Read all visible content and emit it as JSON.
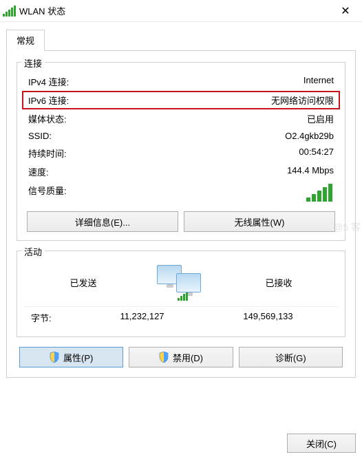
{
  "window": {
    "title": "WLAN 状态",
    "close": "✕"
  },
  "tab": {
    "general": "常规"
  },
  "connection": {
    "legend": "连接",
    "ipv4_label": "IPv4 连接:",
    "ipv4_value": "Internet",
    "ipv6_label": "IPv6 连接:",
    "ipv6_value": "无网络访问权限",
    "media_label": "媒体状态:",
    "media_value": "已启用",
    "ssid_label": "SSID:",
    "ssid_value": "O2.4gkb29b",
    "duration_label": "持续时间:",
    "duration_value": "00:54:27",
    "speed_label": "速度:",
    "speed_value": "144.4 Mbps",
    "signal_label": "信号质量:"
  },
  "buttons": {
    "details": "详细信息(E)...",
    "wireless": "无线属性(W)",
    "properties": "属性(P)",
    "disable": "禁用(D)",
    "diagnose": "诊断(G)",
    "close": "关闭(C)"
  },
  "activity": {
    "legend": "活动",
    "sent": "已发送",
    "received": "已接收",
    "bytes_label": "字节:",
    "bytes_sent": "11,232,127",
    "bytes_recv": "149,569,133"
  },
  "watermark": "@5          客"
}
